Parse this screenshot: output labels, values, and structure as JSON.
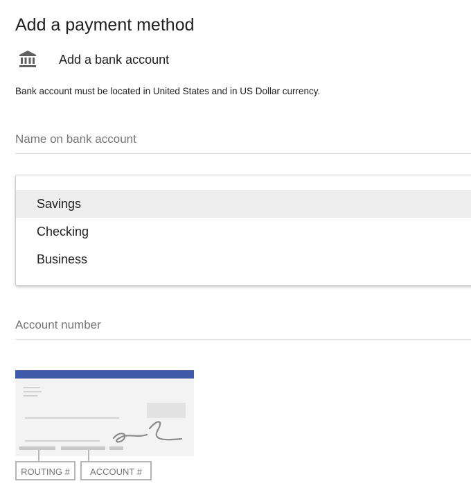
{
  "header": {
    "title": "Add a payment method"
  },
  "method": {
    "icon": "bank-icon",
    "label": "Add a bank account"
  },
  "notice": "Bank account must be located in United States and in US Dollar currency.",
  "fields": {
    "name_placeholder": "Name on bank account",
    "name_value": "",
    "account_number_placeholder": "Account number",
    "account_number_value": ""
  },
  "account_type": {
    "options": [
      "Savings",
      "Checking",
      "Business"
    ],
    "highlighted": "Savings"
  },
  "check_diagram": {
    "routing_label": "ROUTING #",
    "account_label": "ACCOUNT #",
    "header_color": "#3f5aa8"
  }
}
